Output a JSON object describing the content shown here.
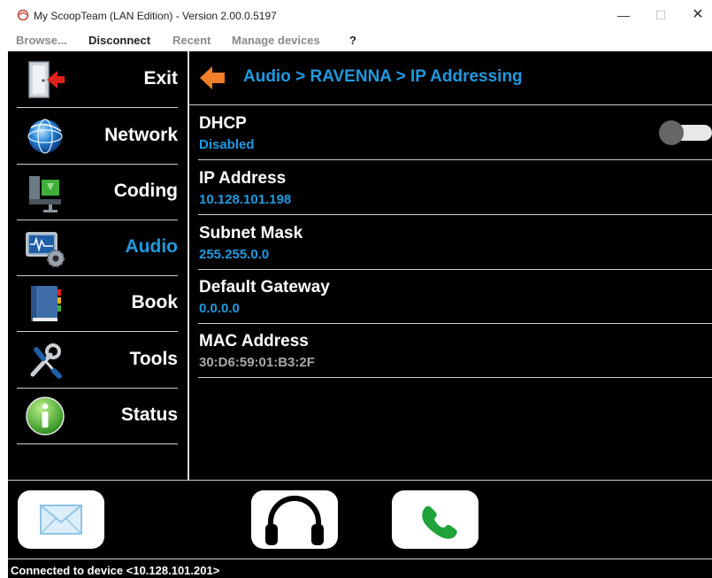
{
  "window": {
    "title": "My ScoopTeam (LAN Edition) - Version 2.00.0.5197",
    "minimize": "—",
    "maximize": "☐",
    "close": "✕"
  },
  "menu": {
    "browse": "Browse...",
    "disconnect": "Disconnect",
    "recent": "Recent",
    "manage_devices": "Manage devices",
    "help": "?"
  },
  "sidebar": {
    "items": [
      {
        "label": "Exit",
        "icon": "exit-door-icon"
      },
      {
        "label": "Network",
        "icon": "globe-icon"
      },
      {
        "label": "Coding",
        "icon": "vise-clamp-icon"
      },
      {
        "label": "Audio",
        "icon": "audio-monitor-gear-icon",
        "active": true
      },
      {
        "label": "Book",
        "icon": "book-icon"
      },
      {
        "label": "Tools",
        "icon": "wrench-screwdriver-icon"
      },
      {
        "label": "Status",
        "icon": "info-icon"
      }
    ]
  },
  "content": {
    "breadcrumb": "Audio > RAVENNA > IP Addressing",
    "fields": [
      {
        "label": "DHCP",
        "value": "Disabled"
      },
      {
        "label": "IP Address",
        "value": "10.128.101.198"
      },
      {
        "label": "Subnet Mask",
        "value": "255.255.0.0"
      },
      {
        "label": "Default Gateway",
        "value": "0.0.0.0"
      },
      {
        "label": "MAC Address",
        "value": "30:D6:59:01:B3:2F"
      }
    ],
    "dhcp_toggle_on": false
  },
  "actions": [
    {
      "icon": "envelope-icon"
    },
    {
      "icon": "headphones-icon"
    },
    {
      "icon": "phone-handset-icon"
    }
  ],
  "status": {
    "text": "Connected to device <10.128.101.201>"
  },
  "colors": {
    "accent": "#1e9ae0",
    "background": "#000000",
    "arrow": "#f07f2a",
    "call_green": "#1fa33a"
  }
}
